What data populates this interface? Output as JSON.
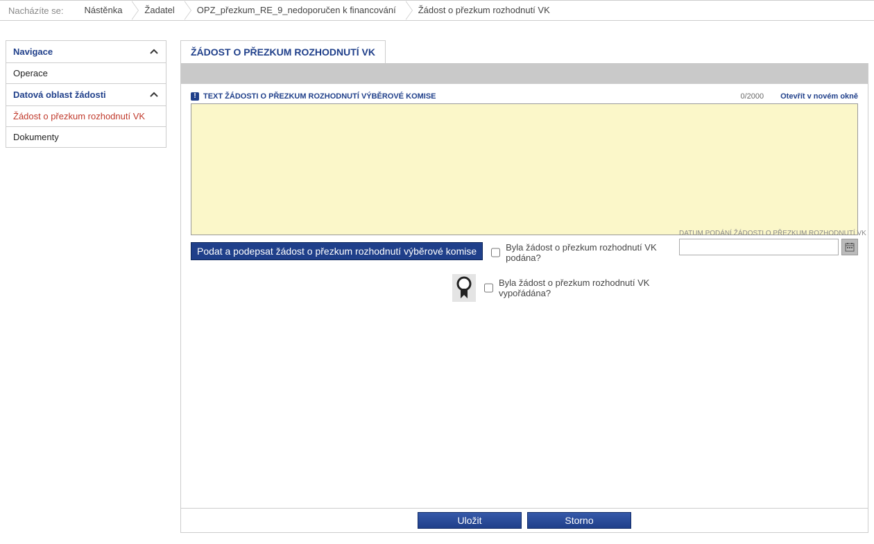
{
  "breadcrumb": {
    "label": "Nacházíte se:",
    "items": [
      "Nástěnka",
      "Žadatel",
      "OPZ_přezkum_RE_9_nedoporučen k financování",
      "Žádost o přezkum rozhodnutí VK"
    ]
  },
  "sidebar": {
    "sections": [
      {
        "title": "Navigace",
        "items": [
          {
            "label": "Operace",
            "active": false
          }
        ]
      },
      {
        "title": "Datová oblast žádosti",
        "items": [
          {
            "label": "Žádost o přezkum rozhodnutí VK",
            "active": true
          },
          {
            "label": "Dokumenty",
            "active": false
          }
        ]
      }
    ]
  },
  "main": {
    "tab_title": "ŽÁDOST O PŘEZKUM ROZHODNUTÍ VK",
    "text_field": {
      "label": "TEXT ŽÁDOSTI O PŘEZKUM ROZHODNUTÍ VÝBĚROVÉ KOMISE",
      "counter": "0/2000",
      "open_link": "Otevřít v novém okně",
      "value": ""
    },
    "submit_button": "Podat a podepsat žádost o přezkum rozhodnutí výběrové komise",
    "check1_label": "Byla žádost o přezkum rozhodnutí VK podána?",
    "check2_label": "Byla žádost o přezkum rozhodnutí VK vypořádána?",
    "date_field": {
      "label": "DATUM PODÁNÍ ŽÁDOSTI O PŘEZKUM ROZHODNUTÍ VK",
      "value": ""
    },
    "footer": {
      "save": "Uložit",
      "cancel": "Storno"
    }
  }
}
